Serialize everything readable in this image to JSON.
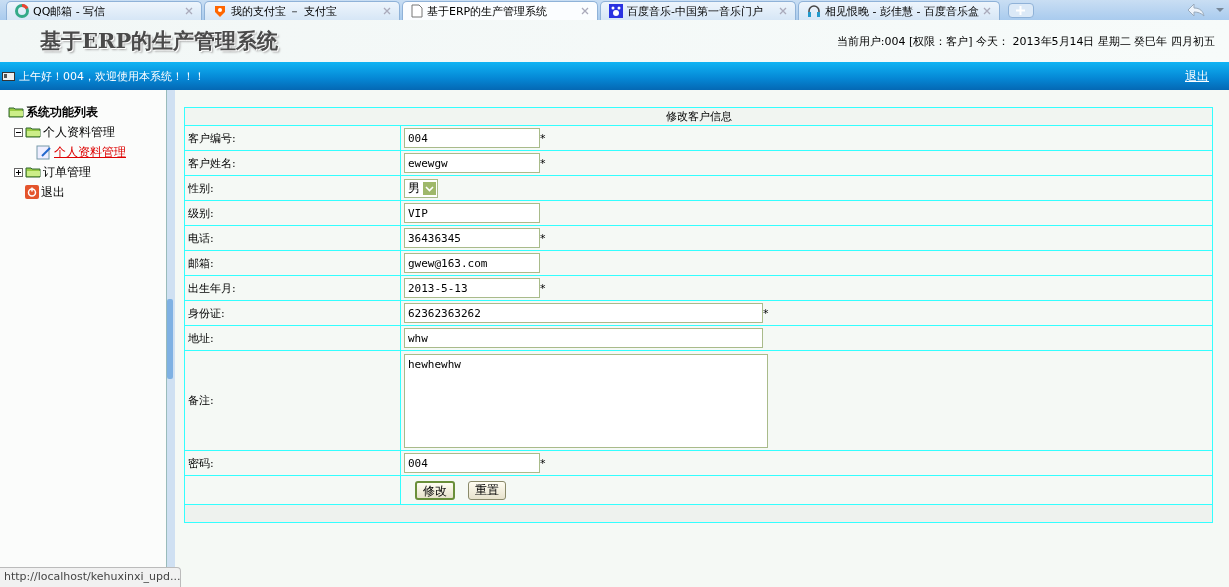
{
  "browser": {
    "tabs": [
      {
        "title": "QQ邮箱 - 写信",
        "selected": false
      },
      {
        "title": "我的支付宝 － 支付宝",
        "selected": false
      },
      {
        "title": "基于ERP的生产管理系统",
        "selected": true
      },
      {
        "title": "百度音乐-中国第一音乐门户",
        "selected": false
      },
      {
        "title": "相见恨晚 - 彭佳慧 - 百度音乐盒",
        "selected": false
      }
    ],
    "status_url": "http://localhost/kehuxinxi_upd..."
  },
  "header": {
    "title": "基于ERP的生产管理系统",
    "user_info": "当前用户:004 [权限：客户] 今天： 2013年5月14日 星期二 癸巳年 四月初五"
  },
  "banner": {
    "greeting": "上午好！004，欢迎使用本系统！！！",
    "logout": "退出"
  },
  "sidebar": {
    "title": "系统功能列表",
    "items": [
      {
        "label": "个人资料管理",
        "kind": "folder",
        "expanded": true,
        "children": [
          {
            "label": "个人资料管理",
            "kind": "page",
            "selected": true
          }
        ]
      },
      {
        "label": "订单管理",
        "kind": "folder",
        "expanded": false
      },
      {
        "label": "退出",
        "kind": "exit"
      }
    ]
  },
  "form": {
    "title": "修改客户信息",
    "rows": [
      {
        "label": "客户编号:",
        "kind": "text",
        "value": "004",
        "required": true,
        "wide": false
      },
      {
        "label": "客户姓名:",
        "kind": "text",
        "value": "ewewgw",
        "required": true,
        "wide": false
      },
      {
        "label": "性别:",
        "kind": "select",
        "value": "男",
        "required": false
      },
      {
        "label": "级别:",
        "kind": "text",
        "value": "VIP",
        "required": false,
        "wide": false
      },
      {
        "label": "电话:",
        "kind": "text",
        "value": "36436345",
        "required": true,
        "wide": false
      },
      {
        "label": "邮箱:",
        "kind": "text",
        "value": "gwew@163.com",
        "required": false,
        "wide": false
      },
      {
        "label": "出生年月:",
        "kind": "text",
        "value": "2013-5-13",
        "required": true,
        "wide": false
      },
      {
        "label": "身份证:",
        "kind": "text",
        "value": "62362363262",
        "required": true,
        "wide": true
      },
      {
        "label": "地址:",
        "kind": "text",
        "value": "whw",
        "required": false,
        "wide": true
      },
      {
        "label": "备注:",
        "kind": "textarea",
        "value": "hewhewhw",
        "required": false
      },
      {
        "label": "密码:",
        "kind": "text",
        "value": "004",
        "required": true,
        "wide": false
      }
    ],
    "required_mark": "*",
    "buttons": [
      {
        "label": "修改",
        "selected": true
      },
      {
        "label": "重置",
        "selected": false
      }
    ]
  }
}
